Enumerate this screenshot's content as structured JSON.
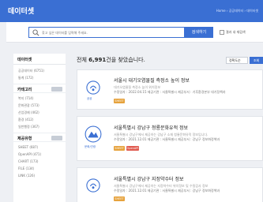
{
  "header": {
    "title": "데이터셋",
    "breadcrumb": "Home › 공공데이터 › 데이터셋"
  },
  "search": {
    "placeholder": "찾고 싶은 데이터를 입력해 주세요.",
    "button": "검색하기",
    "recheck_label": "결과 내 재검색"
  },
  "sidebar": {
    "dataset": {
      "title": "데이터셋",
      "items": [
        "공공데이터 (6751)",
        "통계 (172)"
      ]
    },
    "category": {
      "title": "카테고리",
      "items": [
        "복지 (714)",
        "문화관광 (573)",
        "산업경제 (462)",
        "환경 (412)",
        "일반행정 (367)"
      ]
    },
    "format": {
      "title": "제공유형",
      "items": [
        "SHEET (687)",
        "OpenAPI (471)",
        "CHART (173)",
        "FILE (134)",
        "LINK (126)"
      ]
    }
  },
  "results": {
    "prefix": "전체 ",
    "count": "6,991",
    "suffix": "건을 찾았습니다.",
    "sort": "정확도순",
    "sort_button": "조회"
  },
  "cards": [
    {
      "title": "서울시 대기오염물질 측정소 높이 정보",
      "desc": "대기오염물질 측정소 높이 위치정보",
      "meta": "수정일자 : 2022.04.15    제공기관 : 서울특별시    제공부서 : 기후환경본부 대기정책과",
      "icon_label": "공공",
      "tags": [
        "SHEET"
      ],
      "tag_colors": [
        "#e6a23c"
      ]
    },
    {
      "title": "서울특별시 강남구 청룡문화유적 정보",
      "desc": "서울특별시 강남구에서 제공하는 강남구 소재 청룡문화유적 정보입니다.",
      "meta": "수정일자 : 2021.12.01    제공기관 : 서울특별시    제공부서 : 강남구 정보화정책과",
      "icon_label": "문화/관광",
      "tags": [
        "SHEET",
        "OpenAPI"
      ],
      "tag_colors": [
        "#e6a23c",
        "#e05a4f"
      ]
    },
    {
      "title": "서울특별시 강남구 지정약수터 정보",
      "desc": "서울특별시 강남구에서 제공하는 지정약수터 위치정보 및 수질검사 정보",
      "meta": "수정일자 : 2021.12.01    제공기관 : 서울특별시    제공부서 : 강남구 정보화정책과",
      "icon_label": "공공",
      "tags": [
        "SHEET"
      ],
      "tag_colors": [
        "#e6a23c"
      ]
    }
  ],
  "colors": {
    "brand": "#3a6fd3"
  }
}
